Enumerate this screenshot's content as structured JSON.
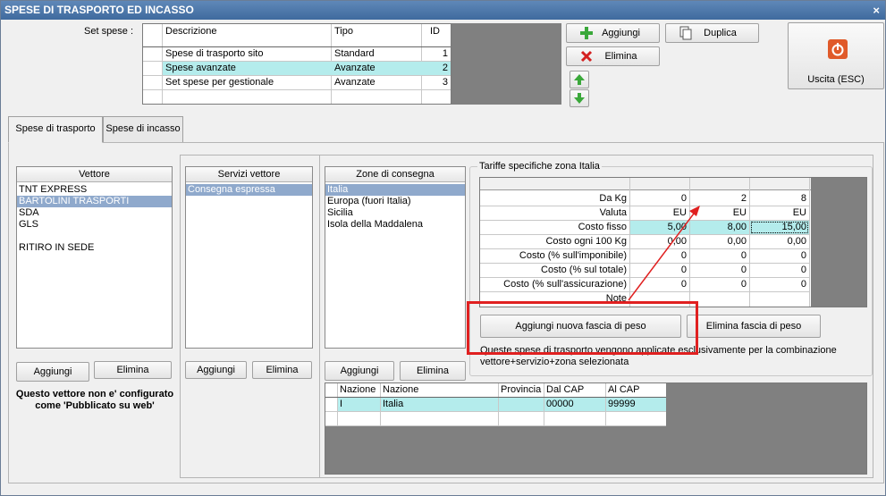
{
  "window": {
    "title": "SPESE DI TRASPORTO ED INCASSO",
    "close_glyph": "×"
  },
  "set_spese": {
    "label": "Set spese :",
    "headers": [
      "Descrizione",
      "Tipo",
      "ID"
    ],
    "rows": [
      {
        "descrizione": "Spese di trasporto sito",
        "tipo": "Standard",
        "id": "1"
      },
      {
        "descrizione": "Spese avanzate",
        "tipo": "Avanzate",
        "id": "2"
      },
      {
        "descrizione": "Set spese per gestionale",
        "tipo": "Avanzate",
        "id": "3"
      }
    ]
  },
  "toolbar": {
    "aggiungi": "Aggiungi",
    "duplica": "Duplica",
    "elimina": "Elimina",
    "uscita": "Uscita (ESC)"
  },
  "tabs": [
    "Spese di trasporto",
    "Spese di incasso"
  ],
  "vettore": {
    "header": "Vettore",
    "items": [
      "TNT EXPRESS",
      "BARTOLINI TRASPORTI",
      "SDA",
      "GLS",
      "",
      "RITIRO IN SEDE"
    ],
    "aggiungi": "Aggiungi",
    "elimina": "Elimina",
    "note": "Questo vettore non e' configurato come 'Pubblicato su web'"
  },
  "servizi": {
    "header": "Servizi vettore",
    "items": [
      "Consegna espressa"
    ],
    "aggiungi": "Aggiungi",
    "elimina": "Elimina"
  },
  "zone": {
    "header": "Zone di consegna",
    "items": [
      "Italia",
      "Europa (fuori Italia)",
      "Sicilia",
      "Isola della Maddalena"
    ],
    "aggiungi": "Aggiungi",
    "elimina": "Elimina"
  },
  "tariffe": {
    "title": "Tariffe specifiche zona Italia",
    "rows": [
      {
        "label": "Da Kg",
        "values": [
          "0",
          "2",
          "8"
        ]
      },
      {
        "label": "Valuta",
        "values": [
          "EU",
          "EU",
          "EU"
        ]
      },
      {
        "label": "Costo fisso",
        "values": [
          "5,00",
          "8,00",
          "15,00"
        ]
      },
      {
        "label": "Costo ogni 100 Kg",
        "values": [
          "0,00",
          "0,00",
          "0,00"
        ]
      },
      {
        "label": "Costo (% sull'imponibile)",
        "values": [
          "0",
          "0",
          "0"
        ]
      },
      {
        "label": "Costo (% sul totale)",
        "values": [
          "0",
          "0",
          "0"
        ]
      },
      {
        "label": "Costo (% sull'assicurazione)",
        "values": [
          "0",
          "0",
          "0"
        ]
      },
      {
        "label": "Note",
        "values": [
          "",
          "",
          ""
        ]
      }
    ],
    "aggiungi_fascia": "Aggiungi nuova fascia di peso",
    "elimina_fascia": "Elimina fascia di peso",
    "info": "Queste spese di trasporto vengono applicate esclusivamente per la combinazione vettore+servizio+zona selezionata"
  },
  "nazioni": {
    "headers": [
      "Nazione",
      "Nazione",
      "Provincia",
      "Dal CAP",
      "Al CAP"
    ],
    "rows": [
      {
        "codice": "I",
        "nazione": "Italia",
        "provincia": "",
        "dal_cap": "00000",
        "al_cap": "99999"
      }
    ]
  },
  "colors": {
    "highlight_red": "#e02020",
    "selection_teal": "#b4ecec",
    "title_blue": "#4a76aa"
  }
}
